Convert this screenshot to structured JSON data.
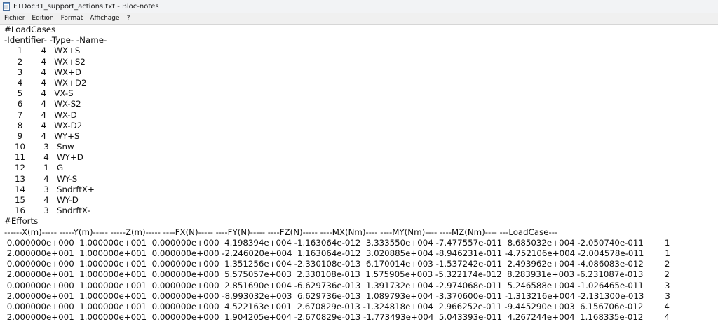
{
  "window": {
    "title": "FTDoc31_support_actions.txt - Bloc-notes",
    "icon": "notepad-icon"
  },
  "menu": {
    "items": [
      "Fichier",
      "Edition",
      "Format",
      "Affichage",
      "?"
    ]
  },
  "document": {
    "lines": [
      "#LoadCases",
      "-Identifier- -Type- -Name-",
      "     1       4   WX+S",
      "     2       4   WX+S2",
      "     3       4   WX+D",
      "     4       4   WX+D2",
      "     5       4   VX-S",
      "     6       4   WX-S2",
      "     7       4   WX-D",
      "     8       4   WX-D2",
      "     9       4   WY+S",
      "    10       3   Snw",
      "    11       4   WY+D",
      "    12       1   G",
      "    13       4   WY-S",
      "    14       3   SndrftX+",
      "    15       4   WY-D",
      "    16       3   SndrftX-",
      "#Efforts",
      "------X(m)----- -----Y(m)----- -----Z(m)----- ----FX(N)----- ----FY(N)----- ----FZ(N)----- ----MX(Nm)---- ----MY(Nm)---- ----MZ(Nm)---- ---LoadCase---",
      " 0.000000e+000  1.000000e+001  0.000000e+000  4.198394e+004 -1.163064e-012  3.333550e+004 -7.477557e-011  8.685032e+004 -2.050740e-011        1",
      " 2.000000e+001  1.000000e+001  0.000000e+000 -2.246020e+004  1.163064e-012  3.020885e+004 -8.946231e-011 -4.752106e+004 -2.004578e-011        1",
      " 0.000000e+000  1.000000e+001  0.000000e+000  1.351256e+004 -2.330108e-013  6.170014e+003 -1.537242e-011  2.493962e+004 -4.086083e-012        2",
      " 2.000000e+001  1.000000e+001  0.000000e+000  5.575057e+003  2.330108e-013  1.575905e+003 -5.322174e-012  8.283931e+003 -6.231087e-013        2",
      " 0.000000e+000  1.000000e+001  0.000000e+000  2.851690e+004 -6.629736e-013  1.391732e+004 -2.974068e-011  5.246588e+004 -1.026465e-011        3",
      " 2.000000e+001  1.000000e+001  0.000000e+000 -8.993032e+003  6.629736e-013  1.089793e+004 -3.370600e-011 -1.313216e+004 -2.131300e-013        3",
      " 0.000000e+000  1.000000e+001  0.000000e+000  4.522163e+001  2.670829e-013 -1.324818e+004  2.966252e-011 -9.445290e+003  6.156706e-012        4",
      " 2.000000e+001  1.000000e+001  0.000000e+000  1.904205e+004 -2.670829e-013 -1.773493e+004  5.043393e-011  4.267244e+004  1.168335e-012        4"
    ]
  }
}
